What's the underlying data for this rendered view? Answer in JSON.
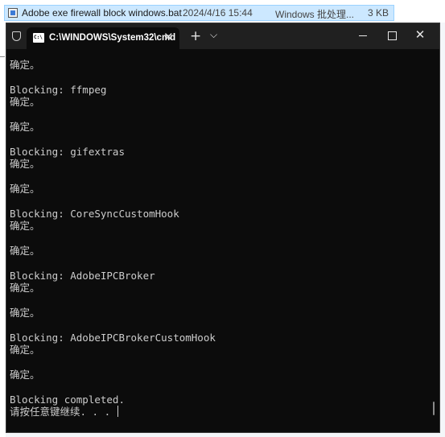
{
  "explorer": {
    "file": {
      "name": "Adobe exe firewall block windows.bat",
      "date": "2024/4/16 15:44",
      "type": "Windows 批处理...",
      "size": "3 KB"
    }
  },
  "terminal": {
    "tab_title": "C:\\WINDOWS\\System32\\cmd",
    "tab_close": "✕",
    "new_tab": "+",
    "dropdown": "⌵",
    "close": "✕",
    "lines": [
      "确定。",
      "",
      "Blocking: ffmpeg",
      "确定。",
      "",
      "确定。",
      "",
      "Blocking: gifextras",
      "确定。",
      "",
      "确定。",
      "",
      "Blocking: CoreSyncCustomHook",
      "确定。",
      "",
      "确定。",
      "",
      "Blocking: AdobeIPCBroker",
      "确定。",
      "",
      "确定。",
      "",
      "Blocking: AdobeIPCBrokerCustomHook",
      "确定。",
      "",
      "确定。",
      "",
      "Blocking completed.",
      "请按任意键继续. . . "
    ]
  }
}
